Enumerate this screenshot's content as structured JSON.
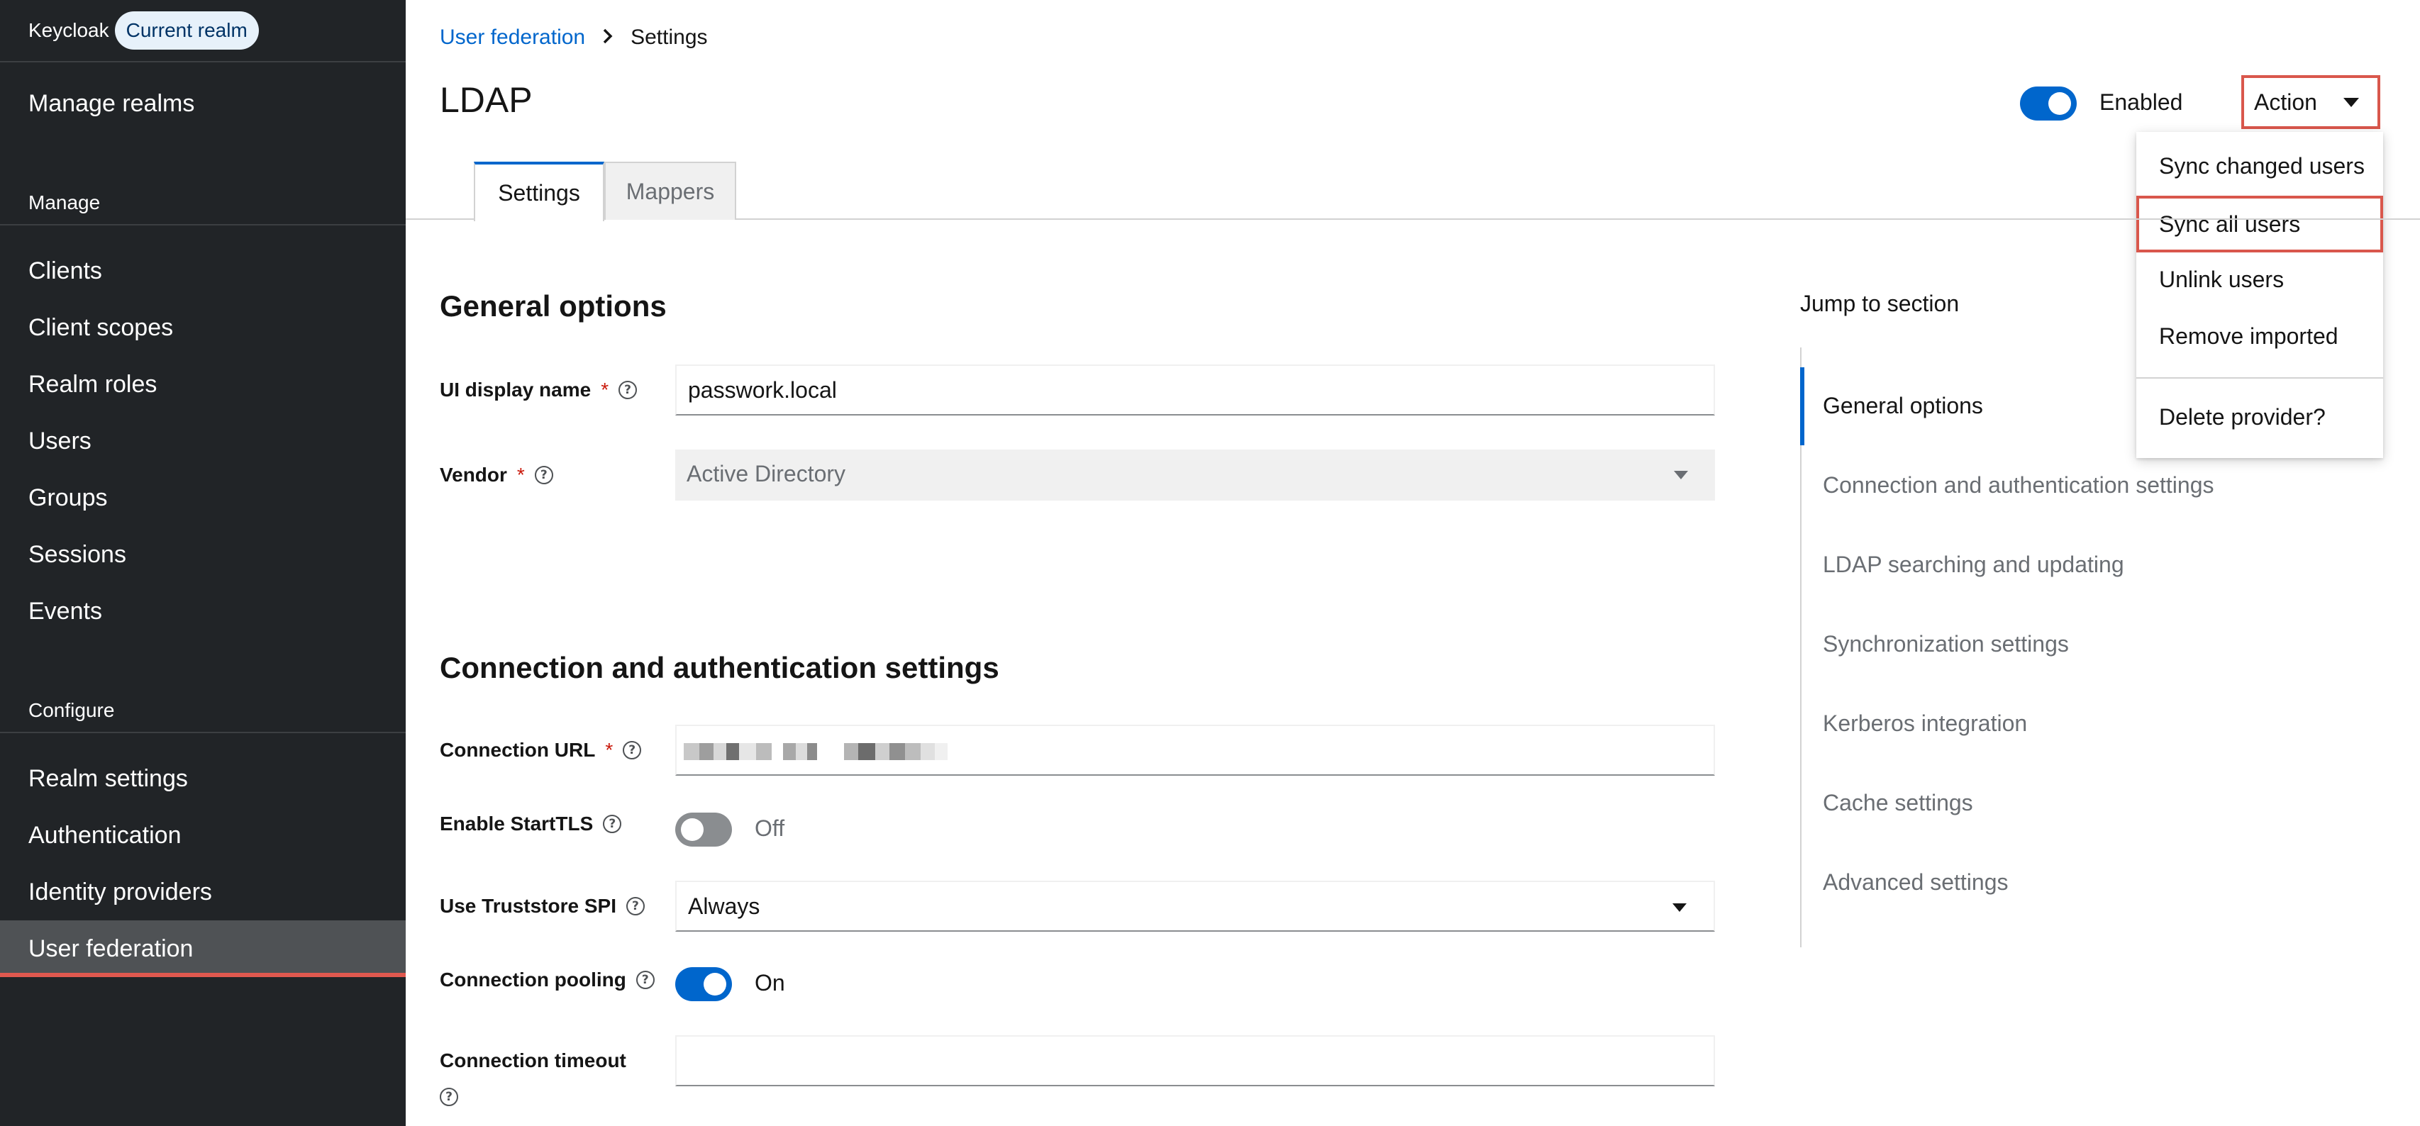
{
  "sidebar": {
    "brand": "Keycloak",
    "realm_pill": "Current realm",
    "manage_realms": "Manage realms",
    "manage_section": "Manage",
    "manage_items": [
      "Clients",
      "Client scopes",
      "Realm roles",
      "Users",
      "Groups",
      "Sessions",
      "Events"
    ],
    "configure_section": "Configure",
    "configure_items": [
      "Realm settings",
      "Authentication",
      "Identity providers",
      "User federation"
    ],
    "active_item": "User federation"
  },
  "breadcrumb": {
    "parent": "User federation",
    "current": "Settings"
  },
  "header": {
    "title": "LDAP",
    "enabled_label": "Enabled",
    "enabled": true,
    "action_label": "Action"
  },
  "action_menu": {
    "items": [
      "Sync changed users",
      "Sync all users",
      "Unlink users",
      "Remove imported"
    ],
    "danger_item": "Delete provider?",
    "highlighted": "Sync all users"
  },
  "tabs": [
    {
      "label": "Settings",
      "active": true
    },
    {
      "label": "Mappers",
      "active": false
    }
  ],
  "general_options": {
    "heading": "General options",
    "ui_display_name_label": "UI display name",
    "ui_display_name_value": "passwork.local",
    "vendor_label": "Vendor",
    "vendor_value": "Active Directory"
  },
  "connection": {
    "heading": "Connection and authentication settings",
    "url_label": "Connection URL",
    "starttls_label": "Enable StartTLS",
    "starttls_state": "Off",
    "truststore_label": "Use Truststore SPI",
    "truststore_value": "Always",
    "pooling_label": "Connection pooling",
    "pooling_state": "On",
    "timeout_label": "Connection timeout",
    "timeout_value": ""
  },
  "jump_to_section": {
    "title": "Jump to section",
    "items": [
      "General options",
      "Connection and authentication settings",
      "LDAP searching and updating",
      "Synchronization settings",
      "Kerberos integration",
      "Cache settings",
      "Advanced settings"
    ],
    "active": "General options"
  },
  "colors": {
    "sidebar_bg": "#212427",
    "accent": "#0066cc",
    "highlight_border": "#d9574c",
    "active_nav_bg": "#4f5255"
  },
  "icons": [
    "chevron-right-icon",
    "caret-down-icon",
    "help-icon"
  ]
}
